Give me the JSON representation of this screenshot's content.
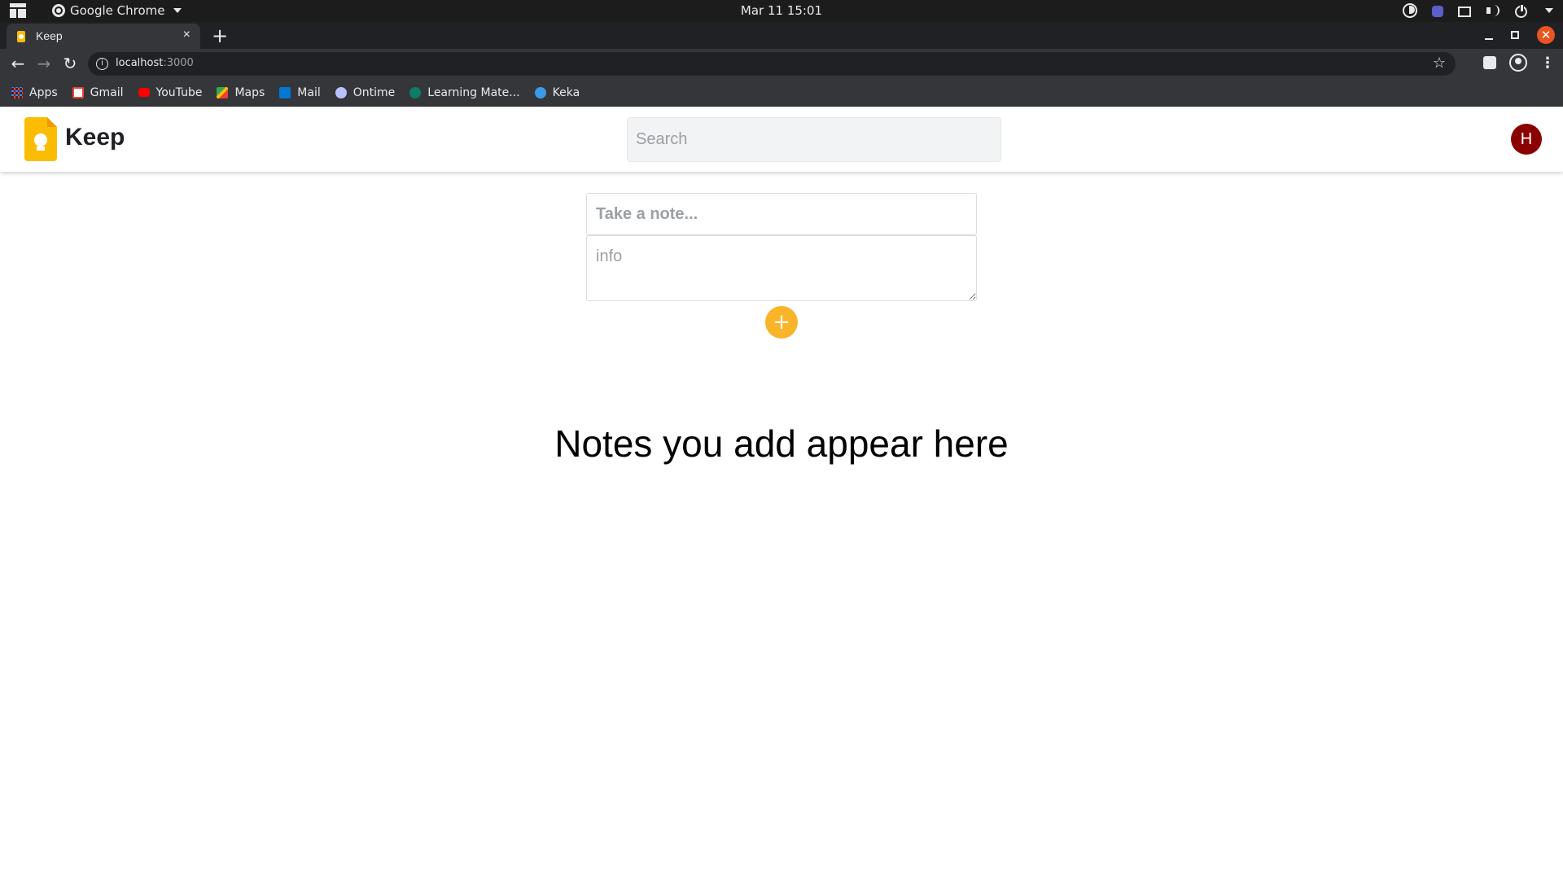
{
  "os_bar": {
    "app_name": "Google Chrome",
    "clock": "Mar 11  15:01"
  },
  "browser": {
    "tab_title": "Keep",
    "tab_close": "×",
    "new_tab": "+",
    "url_host": "localhost",
    "url_port": ":3000",
    "close_glyph": "✕",
    "bookmarks": [
      {
        "label": "Apps",
        "icon": "apps-icon"
      },
      {
        "label": "Gmail",
        "icon": "gmail-icon"
      },
      {
        "label": "YouTube",
        "icon": "youtube-icon"
      },
      {
        "label": "Maps",
        "icon": "maps-icon"
      },
      {
        "label": "Mail",
        "icon": "outlook-mail-icon"
      },
      {
        "label": "Ontime",
        "icon": "ontime-icon"
      },
      {
        "label": "Learning Mate...",
        "icon": "learning-mate-icon"
      },
      {
        "label": "Keka",
        "icon": "keka-icon"
      }
    ]
  },
  "app": {
    "title": "Keep",
    "search_placeholder": "Search",
    "avatar_initial": "H",
    "brand_color": "#fbbc04",
    "avatar_color": "#8b0000"
  },
  "composer": {
    "title_placeholder": "Take a note...",
    "body_placeholder": "info",
    "add_label": "+"
  },
  "main": {
    "empty_message": "Notes you add appear here"
  }
}
